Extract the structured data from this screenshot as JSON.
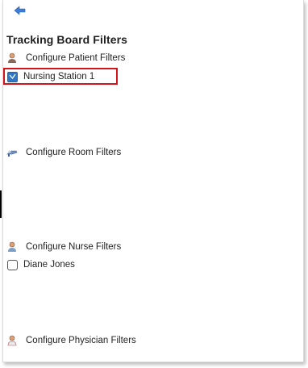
{
  "header": {
    "back_icon": "back-arrow-icon"
  },
  "panel": {
    "title": "Tracking Board Filters"
  },
  "sections": {
    "patient": {
      "label": "Configure Patient Filters",
      "icon": "patient-person-icon"
    },
    "room": {
      "label": "Configure Room Filters",
      "icon": "room-bed-icon"
    },
    "nurse": {
      "label": "Configure Nurse Filters",
      "icon": "nurse-person-icon"
    },
    "physician": {
      "label": "Configure Physician Filters",
      "icon": "physician-person-icon"
    }
  },
  "filters": {
    "patient_items": [
      {
        "label": "Nursing Station 1",
        "checked": true
      }
    ],
    "nurse_items": [
      {
        "label": "Diane Jones",
        "checked": false
      }
    ]
  },
  "colors": {
    "checkbox_checked": "#2f76c4",
    "highlight_border": "#d3141c",
    "back_icon": "#3b7dd8"
  }
}
